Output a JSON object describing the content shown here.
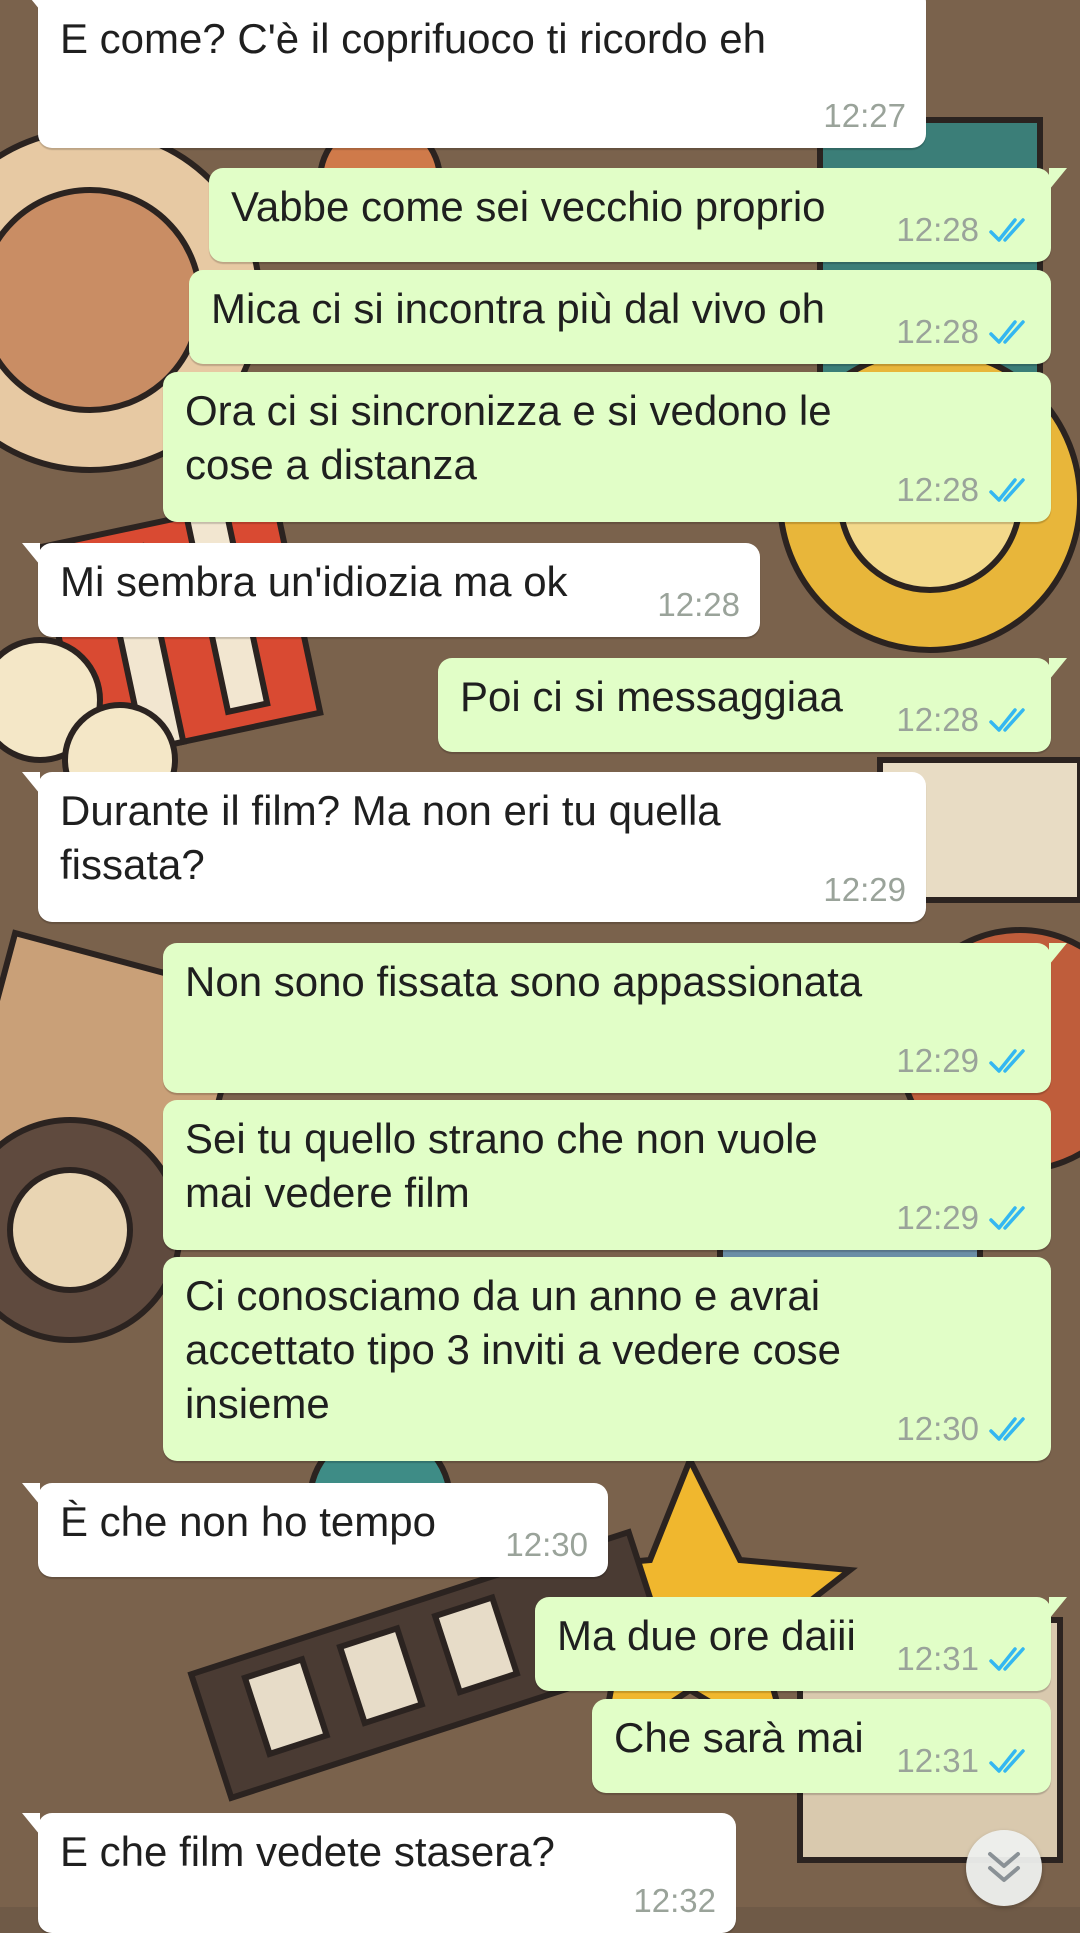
{
  "colors": {
    "incoming_bubble": "#ffffff",
    "outgoing_bubble": "#e1fec7",
    "timestamp": "#9aa39a",
    "read_ticks": "#34b7f1"
  },
  "messages": [
    {
      "direction": "incoming",
      "text": "E come? C'è il coprifuoco ti ricordo eh",
      "time": "12:27"
    },
    {
      "direction": "outgoing",
      "text": "Vabbe come sei vecchio proprio",
      "time": "12:28",
      "status_icon": "double-check-read"
    },
    {
      "direction": "outgoing",
      "text": "Mica ci si incontra più dal vivo oh",
      "time": "12:28",
      "status_icon": "double-check-read"
    },
    {
      "direction": "outgoing",
      "text": "Ora ci si sincronizza e si vedono le cose a distanza",
      "time": "12:28",
      "status_icon": "double-check-read"
    },
    {
      "direction": "incoming",
      "text": "Mi sembra un'idiozia ma ok",
      "time": "12:28"
    },
    {
      "direction": "outgoing",
      "text": "Poi ci si messaggiaa",
      "time": "12:28",
      "status_icon": "double-check-read"
    },
    {
      "direction": "incoming",
      "text": "Durante il film? Ma non eri tu quella fissata?",
      "time": "12:29"
    },
    {
      "direction": "outgoing",
      "text": "Non sono fissata sono appassionata",
      "time": "12:29",
      "status_icon": "double-check-read"
    },
    {
      "direction": "outgoing",
      "text": "Sei tu quello strano che non vuole mai vedere film",
      "time": "12:29",
      "status_icon": "double-check-read"
    },
    {
      "direction": "outgoing",
      "text": "Ci conosciamo da un anno e avrai accettato tipo 3 inviti a vedere cose insieme",
      "time": "12:30",
      "status_icon": "double-check-read"
    },
    {
      "direction": "incoming",
      "text": "È che non ho tempo",
      "time": "12:30"
    },
    {
      "direction": "outgoing",
      "text": "Ma due ore daiii",
      "time": "12:31",
      "status_icon": "double-check-read"
    },
    {
      "direction": "outgoing",
      "text": "Che sarà mai",
      "time": "12:31",
      "status_icon": "double-check-read"
    },
    {
      "direction": "incoming",
      "text": "E che film vedete stasera?",
      "time": "12:32"
    }
  ],
  "scroll_button": {
    "icon": "double-chevron-down-icon"
  },
  "wallpaper": {
    "theme": "cinema doodle pattern"
  }
}
